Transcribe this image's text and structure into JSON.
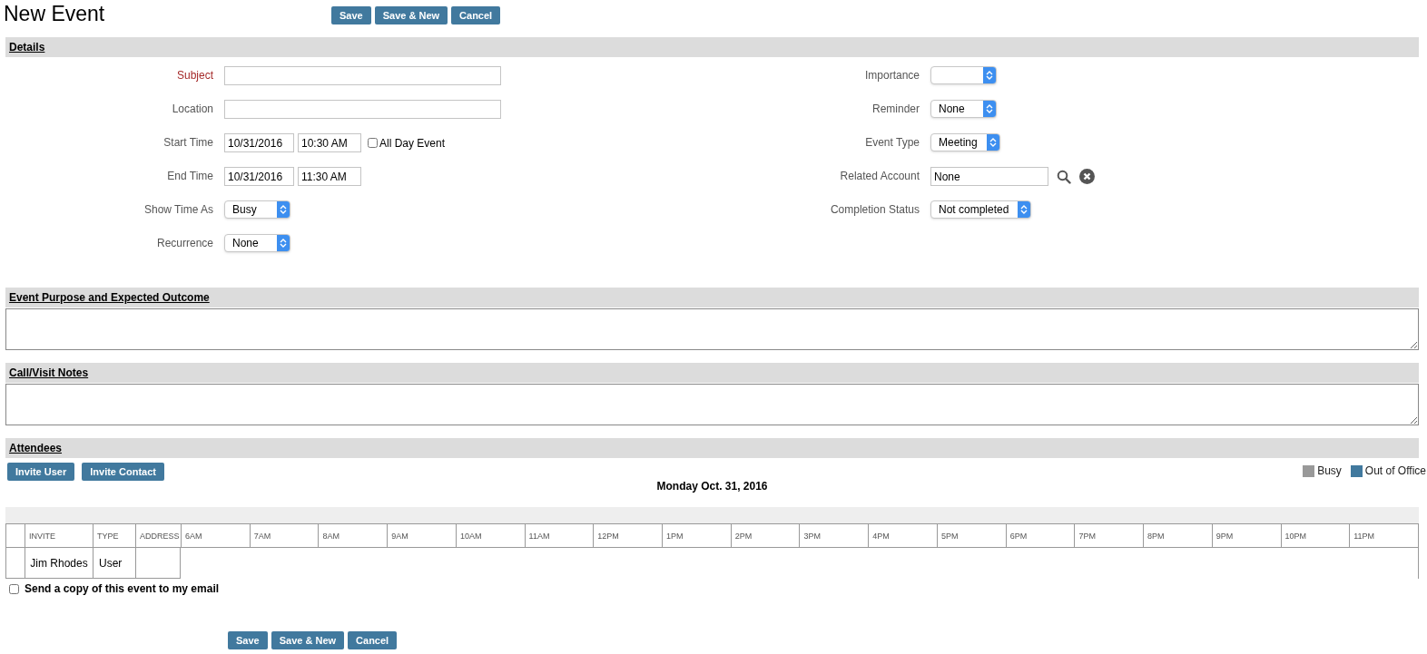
{
  "title": "New Event",
  "top_buttons": [
    "Save",
    "Save & New",
    "Cancel"
  ],
  "details": {
    "heading": "Details",
    "left_fields": [
      {
        "kind": "text",
        "label": "Subject",
        "required": true
      },
      {
        "kind": "text",
        "label": "Location",
        "required": false
      },
      {
        "kind": "datetime",
        "label": "Start Time",
        "required": false,
        "date": "10/31/2016",
        "time": "10:30 AM",
        "checkbox": {
          "label": "All Day Event",
          "checked": false
        }
      },
      {
        "kind": "datetime",
        "label": "End Time",
        "required": false,
        "date": "10/31/2016",
        "time": "11:30 AM"
      },
      {
        "kind": "select",
        "label": "Show Time As",
        "required": false,
        "value": "Busy"
      },
      {
        "kind": "select",
        "label": "Recurrence",
        "required": false,
        "value": "None"
      }
    ],
    "right_fields": [
      {
        "kind": "select",
        "label": "Importance",
        "required": false
      },
      {
        "kind": "select",
        "label": "Reminder",
        "required": false,
        "value": "None"
      },
      {
        "kind": "select",
        "label": "Event Type",
        "required": false,
        "value": "Meeting"
      },
      {
        "kind": "lookup",
        "label": "Related Account",
        "required": false,
        "value": "None"
      },
      {
        "kind": "select",
        "label": "Completion Status",
        "required": false,
        "value": "Not completed"
      }
    ]
  },
  "purpose": {
    "heading": "Event Purpose and Expected Outcome"
  },
  "notes": {
    "heading": "Call/Visit Notes"
  },
  "attendees": {
    "heading": "Attendees",
    "buttons": [
      "Invite User",
      "Invite Contact"
    ],
    "legend": [
      {
        "label": "Busy",
        "color": "#999999"
      },
      {
        "label": "Out of Office",
        "color": "#41799e"
      }
    ],
    "date": "Monday Oct. 31, 2016",
    "columns": [
      "INVITE",
      "TYPE",
      "ADDRESS",
      "6AM",
      "7AM",
      "8AM",
      "9AM",
      "10AM",
      "11AM",
      "12PM",
      "1PM",
      "2PM",
      "3PM",
      "4PM",
      "5PM",
      "6PM",
      "7PM",
      "8PM",
      "9PM",
      "10PM",
      "11PM"
    ],
    "rows": [
      {
        "invite": "Jim Rhodes",
        "type": "User"
      }
    ]
  },
  "email_copy": {
    "label": "Send a copy of this event to my email",
    "checked": false
  },
  "bottom_buttons": [
    "Save",
    "Save & New",
    "Cancel"
  ]
}
